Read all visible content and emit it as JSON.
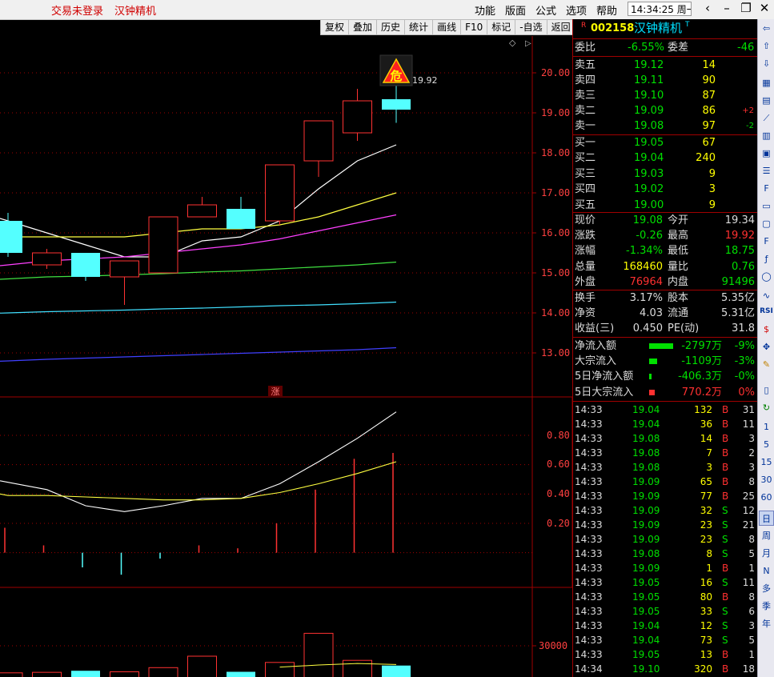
{
  "topbar": {
    "login_status": "交易未登录",
    "stock_name": "汉钟精机",
    "menus": [
      "功能",
      "版面",
      "公式",
      "选项",
      "帮助"
    ],
    "time": "14:34:25 周一"
  },
  "toolbar": [
    "复权",
    "叠加",
    "历史",
    "统计",
    "画线",
    "F10",
    "标记",
    "-自选",
    "返回"
  ],
  "chart": {
    "warning_badge": "危",
    "high_label": "19.92",
    "zhang_marker": "涨",
    "price_axis": [
      "20.00",
      "19.00",
      "18.00",
      "17.00",
      "16.00",
      "15.00",
      "14.00",
      "13.00"
    ],
    "indicator_axis": [
      "0.80",
      "0.60",
      "0.40",
      "0.20"
    ],
    "volume_axis": [
      "30000"
    ]
  },
  "chart_data": {
    "type": "candlestick",
    "candles": [
      {
        "open": 15.5,
        "close": 16.3,
        "high": 16.5,
        "low": 15.4,
        "color": "cyan"
      },
      {
        "open": 15.2,
        "close": 15.5,
        "high": 15.6,
        "low": 15.1,
        "color": "red"
      },
      {
        "open": 15.5,
        "close": 14.9,
        "high": 15.5,
        "low": 14.8,
        "color": "cyan"
      },
      {
        "open": 14.9,
        "close": 15.3,
        "high": 15.3,
        "low": 14.2,
        "color": "red"
      },
      {
        "open": 15.0,
        "close": 16.4,
        "high": 16.4,
        "low": 15.0,
        "color": "red"
      },
      {
        "open": 16.4,
        "close": 16.7,
        "high": 16.9,
        "low": 16.4,
        "color": "red"
      },
      {
        "open": 16.6,
        "close": 16.1,
        "high": 16.9,
        "low": 16.1,
        "color": "cyan"
      },
      {
        "open": 16.3,
        "close": 17.7,
        "high": 17.7,
        "low": 16.2,
        "color": "red"
      },
      {
        "open": 17.8,
        "close": 18.8,
        "high": 18.8,
        "low": 17.4,
        "color": "red"
      },
      {
        "open": 18.5,
        "close": 19.3,
        "high": 19.6,
        "low": 18.3,
        "color": "red"
      },
      {
        "open": 19.34,
        "close": 19.08,
        "high": 19.92,
        "low": 18.75,
        "color": "cyan"
      }
    ],
    "price_ylim": [
      12.8,
      20.4
    ],
    "ma_lines": [
      {
        "color": "#ffffff",
        "values": [
          16.3,
          16.0,
          15.7,
          15.4,
          15.4,
          15.8,
          15.9,
          16.3,
          17.1,
          17.8,
          18.2
        ]
      },
      {
        "color": "#ffff40",
        "values": [
          15.9,
          15.9,
          15.9,
          15.9,
          16.0,
          16.1,
          16.1,
          16.2,
          16.4,
          16.7,
          17.0
        ]
      },
      {
        "color": "#ff40ff",
        "values": [
          15.2,
          15.3,
          15.35,
          15.4,
          15.5,
          15.6,
          15.7,
          15.85,
          16.05,
          16.25,
          16.45
        ]
      },
      {
        "color": "#40e040",
        "values": [
          14.85,
          14.9,
          14.92,
          14.95,
          14.98,
          15.02,
          15.05,
          15.1,
          15.15,
          15.2,
          15.27
        ]
      },
      {
        "color": "#40e0ff",
        "values": [
          14.0,
          14.03,
          14.05,
          14.07,
          14.1,
          14.12,
          14.15,
          14.18,
          14.2,
          14.23,
          14.27
        ]
      },
      {
        "color": "#4040ff",
        "values": [
          12.8,
          12.84,
          12.87,
          12.9,
          12.93,
          12.96,
          12.99,
          13.02,
          13.05,
          13.08,
          13.13
        ]
      }
    ],
    "indicator": {
      "ylim": [
        0,
        1.0
      ],
      "white": [
        0.48,
        0.43,
        0.32,
        0.28,
        0.32,
        0.37,
        0.37,
        0.47,
        0.62,
        0.78,
        0.96
      ],
      "yellow": [
        0.39,
        0.39,
        0.38,
        0.37,
        0.36,
        0.36,
        0.37,
        0.41,
        0.47,
        0.54,
        0.62
      ],
      "bars": [
        0.17,
        0.05,
        -0.1,
        -0.15,
        -0.04,
        0.05,
        0.03,
        0.2,
        0.43,
        0.64,
        0.68
      ]
    },
    "volume": {
      "ylim": [
        0,
        48000
      ],
      "bars": [
        4000,
        4500,
        6000,
        5000,
        9000,
        20000,
        5000,
        14000,
        42000,
        16000,
        11000
      ],
      "colors": [
        "red",
        "red",
        "cyan",
        "red",
        "red",
        "red",
        "cyan",
        "red",
        "red",
        "red",
        "cyan"
      ],
      "ma": [
        null,
        null,
        null,
        null,
        null,
        null,
        null,
        9500,
        11500,
        13000,
        12000
      ]
    }
  },
  "quote": {
    "code": "002158",
    "name": "汉钟精机",
    "r_flag": "R",
    "t_flag": "T",
    "weibi_label": "委比",
    "weibi": "-6.55%",
    "weicha_label": "委差",
    "weicha": "-46",
    "asks": [
      {
        "label": "卖五",
        "price": "19.12",
        "vol": "14",
        "chg": ""
      },
      {
        "label": "卖四",
        "price": "19.11",
        "vol": "90",
        "chg": ""
      },
      {
        "label": "卖三",
        "price": "19.10",
        "vol": "87",
        "chg": ""
      },
      {
        "label": "卖二",
        "price": "19.09",
        "vol": "86",
        "chg": "+2"
      },
      {
        "label": "卖一",
        "price": "19.08",
        "vol": "97",
        "chg": "-2"
      }
    ],
    "bids": [
      {
        "label": "买一",
        "price": "19.05",
        "vol": "67"
      },
      {
        "label": "买二",
        "price": "19.04",
        "vol": "240"
      },
      {
        "label": "买三",
        "price": "19.03",
        "vol": "9"
      },
      {
        "label": "买四",
        "price": "19.02",
        "vol": "3"
      },
      {
        "label": "买五",
        "price": "19.00",
        "vol": "9"
      }
    ],
    "stats": [
      {
        "l1": "现价",
        "v1": "19.08",
        "c1": "gr",
        "l2": "今开",
        "v2": "19.34",
        "c2": "wt"
      },
      {
        "l1": "涨跌",
        "v1": "-0.26",
        "c1": "gr",
        "l2": "最高",
        "v2": "19.92",
        "c2": "rd"
      },
      {
        "l1": "涨幅",
        "v1": "-1.34%",
        "c1": "gr",
        "l2": "最低",
        "v2": "18.75",
        "c2": "gr"
      },
      {
        "l1": "总量",
        "v1": "168460",
        "c1": "yl",
        "l2": "量比",
        "v2": "0.76",
        "c2": "gr"
      },
      {
        "l1": "外盘",
        "v1": "76964",
        "c1": "rd",
        "l2": "内盘",
        "v2": "91496",
        "c2": "gr"
      }
    ],
    "stats2": [
      {
        "l1": "换手",
        "v1": "3.17%",
        "l2": "股本",
        "v2": "5.35亿"
      },
      {
        "l1": "净资",
        "v1": "4.03",
        "l2": "流通",
        "v2": "5.31亿"
      },
      {
        "l1": "收益(三)",
        "v1": "0.450",
        "l2": "PE(动)",
        "v2": "31.8"
      }
    ],
    "flows": [
      {
        "label": "净流入额",
        "val": "-2797万",
        "pct": "-9%",
        "c": "gr",
        "bar": 30
      },
      {
        "label": "大宗流入",
        "val": "-1109万",
        "pct": "-3%",
        "c": "gr",
        "bar": 10
      },
      {
        "label": "5日净流入额",
        "val": "-406.3万",
        "pct": "-0%",
        "c": "gr",
        "bar": 3
      },
      {
        "label": "5日大宗流入",
        "val": "770.2万",
        "pct": "0%",
        "c": "rd",
        "bar": 7
      }
    ],
    "ticks": [
      {
        "t": "14:33",
        "p": "19.04",
        "v": "132",
        "s": "B",
        "n": "31"
      },
      {
        "t": "14:33",
        "p": "19.04",
        "v": "36",
        "s": "B",
        "n": "11"
      },
      {
        "t": "14:33",
        "p": "19.08",
        "v": "14",
        "s": "B",
        "n": "3"
      },
      {
        "t": "14:33",
        "p": "19.08",
        "v": "7",
        "s": "B",
        "n": "2"
      },
      {
        "t": "14:33",
        "p": "19.08",
        "v": "3",
        "s": "B",
        "n": "3"
      },
      {
        "t": "14:33",
        "p": "19.09",
        "v": "65",
        "s": "B",
        "n": "8"
      },
      {
        "t": "14:33",
        "p": "19.09",
        "v": "77",
        "s": "B",
        "n": "25"
      },
      {
        "t": "14:33",
        "p": "19.09",
        "v": "32",
        "s": "S",
        "n": "12"
      },
      {
        "t": "14:33",
        "p": "19.09",
        "v": "23",
        "s": "S",
        "n": "21"
      },
      {
        "t": "14:33",
        "p": "19.09",
        "v": "23",
        "s": "S",
        "n": "8"
      },
      {
        "t": "14:33",
        "p": "19.08",
        "v": "8",
        "s": "S",
        "n": "5"
      },
      {
        "t": "14:33",
        "p": "19.09",
        "v": "1",
        "s": "B",
        "n": "1"
      },
      {
        "t": "14:33",
        "p": "19.05",
        "v": "16",
        "s": "S",
        "n": "11"
      },
      {
        "t": "14:33",
        "p": "19.05",
        "v": "80",
        "s": "B",
        "n": "8"
      },
      {
        "t": "14:33",
        "p": "19.05",
        "v": "33",
        "s": "S",
        "n": "6"
      },
      {
        "t": "14:33",
        "p": "19.04",
        "v": "12",
        "s": "S",
        "n": "3"
      },
      {
        "t": "14:33",
        "p": "19.04",
        "v": "73",
        "s": "S",
        "n": "5"
      },
      {
        "t": "14:33",
        "p": "19.05",
        "v": "13",
        "s": "B",
        "n": "1"
      },
      {
        "t": "14:34",
        "p": "19.10",
        "v": "320",
        "s": "B",
        "n": "18"
      }
    ]
  },
  "sidebar": {
    "items": [
      "RSI",
      "1",
      "5",
      "15",
      "30",
      "60",
      "日",
      "周",
      "月",
      "N",
      "多",
      "季",
      "年"
    ]
  },
  "colors": {
    "up": "#ff3232",
    "down": "#54ffff",
    "grid": "#a00000"
  }
}
